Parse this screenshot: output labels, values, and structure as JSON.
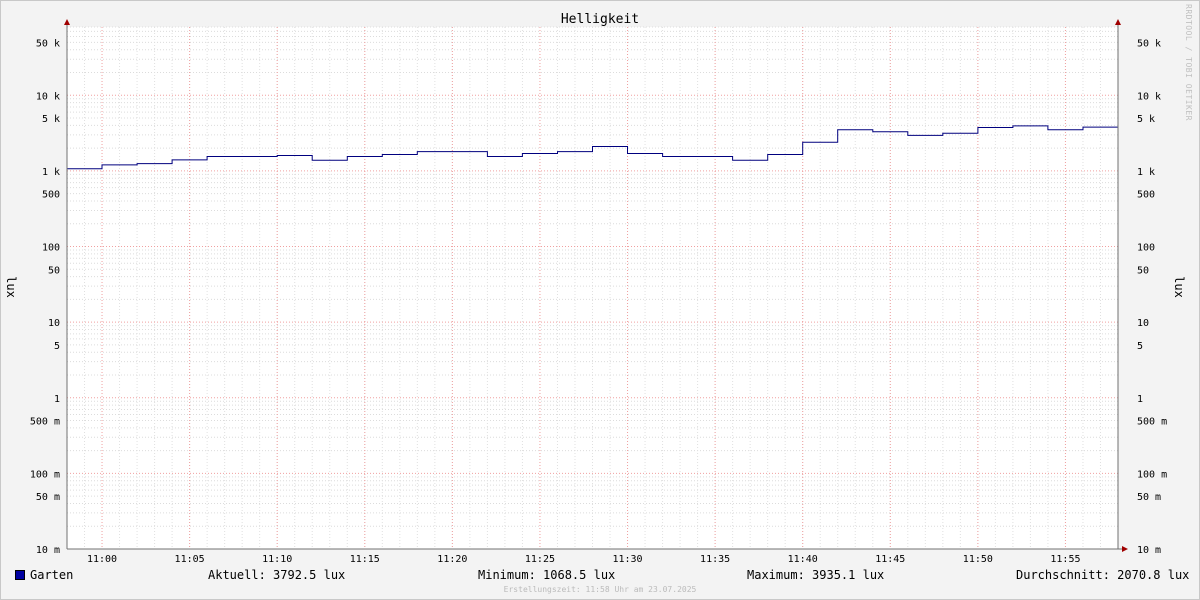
{
  "chart_data": {
    "type": "line",
    "title": "Helligkeit",
    "ylabel": "lux",
    "ylabel_right": "lux",
    "scale": "log",
    "ylim": [
      0.01,
      80000
    ],
    "x_tick_labels": [
      "11:00",
      "11:05",
      "11:10",
      "11:15",
      "11:20",
      "11:25",
      "11:30",
      "11:35",
      "11:40",
      "11:45",
      "11:50",
      "11:55"
    ],
    "y_tick_labels": [
      {
        "value": 50000,
        "label": "50 k"
      },
      {
        "value": 10000,
        "label": "10 k"
      },
      {
        "value": 5000,
        "label": "5 k"
      },
      {
        "value": 1000,
        "label": "1 k"
      },
      {
        "value": 500,
        "label": "500"
      },
      {
        "value": 100,
        "label": "100"
      },
      {
        "value": 50,
        "label": "50"
      },
      {
        "value": 10,
        "label": "10"
      },
      {
        "value": 5,
        "label": "5"
      },
      {
        "value": 1,
        "label": "1"
      },
      {
        "value": 0.5,
        "label": "500 m"
      },
      {
        "value": 0.1,
        "label": "100 m"
      },
      {
        "value": 0.05,
        "label": "50 m"
      },
      {
        "value": 0.01,
        "label": "10 m"
      }
    ],
    "grid": true,
    "legend_position": "bottom",
    "series": [
      {
        "name": "Garten",
        "color": "#00007f",
        "step": true,
        "x": [
          "10:58",
          "11:00",
          "11:02",
          "11:04",
          "11:06",
          "11:08",
          "11:10",
          "11:12",
          "11:14",
          "11:16",
          "11:18",
          "11:20",
          "11:22",
          "11:24",
          "11:26",
          "11:28",
          "11:30",
          "11:32",
          "11:34",
          "11:36",
          "11:38",
          "11:40",
          "11:42",
          "11:44",
          "11:46",
          "11:48",
          "11:50",
          "11:52",
          "11:54",
          "11:56"
        ],
        "values": [
          1068.5,
          1200,
          1250,
          1400,
          1550,
          1550,
          1600,
          1380,
          1550,
          1650,
          1800,
          1800,
          1550,
          1700,
          1800,
          2100,
          1700,
          1550,
          1550,
          1380,
          1650,
          2400,
          3500,
          3300,
          2950,
          3150,
          3750,
          3935.1,
          3500,
          3792.5
        ]
      }
    ]
  },
  "legend": {
    "series_name": "Garten",
    "swatch_color": "#0000a0",
    "current": "Aktuell: 3792.5 lux",
    "minimum": "Minimum: 1068.5 lux",
    "maximum": "Maximum: 3935.1 lux",
    "average": "Durchschnitt: 2070.8 lux"
  },
  "footer": "Erstellungszeit: 11:58 Uhr am 23.07.2025",
  "watermark": "RRDTOOL / TOBI OETIKER"
}
